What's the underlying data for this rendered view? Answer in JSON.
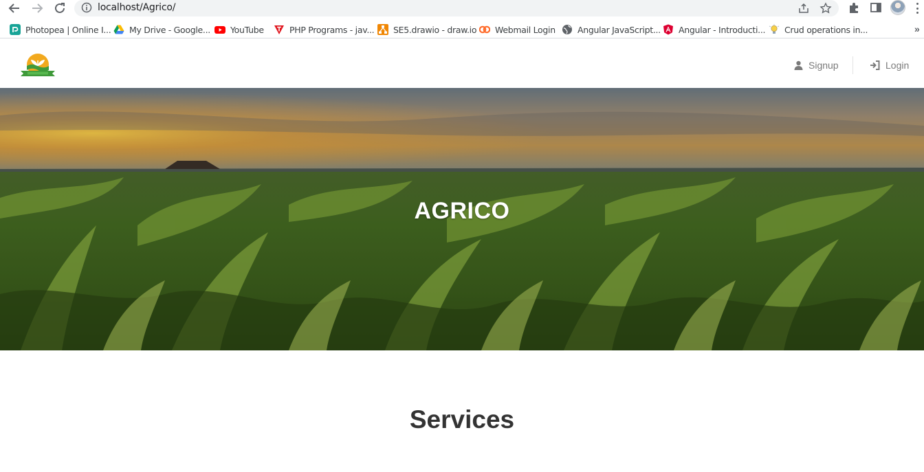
{
  "browser": {
    "url": "localhost/Agrico/",
    "bookmarks": [
      {
        "label": "Photopea | Online I...",
        "icon": "photopea-icon"
      },
      {
        "label": "My Drive - Google...",
        "icon": "google-drive-icon"
      },
      {
        "label": "YouTube",
        "icon": "youtube-icon"
      },
      {
        "label": "PHP Programs - jav...",
        "icon": "tpoint-icon"
      },
      {
        "label": "SE5.drawio - draw.io",
        "icon": "drawio-icon"
      },
      {
        "label": "Webmail Login",
        "icon": "cpanel-icon"
      },
      {
        "label": "Angular JavaScript...",
        "icon": "globe-icon"
      },
      {
        "label": "Angular - Introducti...",
        "icon": "angular-icon"
      },
      {
        "label": "Crud operations in...",
        "icon": "bulb-icon"
      }
    ],
    "more_bookmarks": "»"
  },
  "header": {
    "logo": "agrico-logo",
    "signup_label": "Signup",
    "login_label": "Login"
  },
  "hero": {
    "title": "AGRICO"
  },
  "services": {
    "title": "Services"
  },
  "colors": {
    "header_link": "#7a7a7a",
    "hero_text": "#ffffff",
    "heading": "#333333"
  }
}
